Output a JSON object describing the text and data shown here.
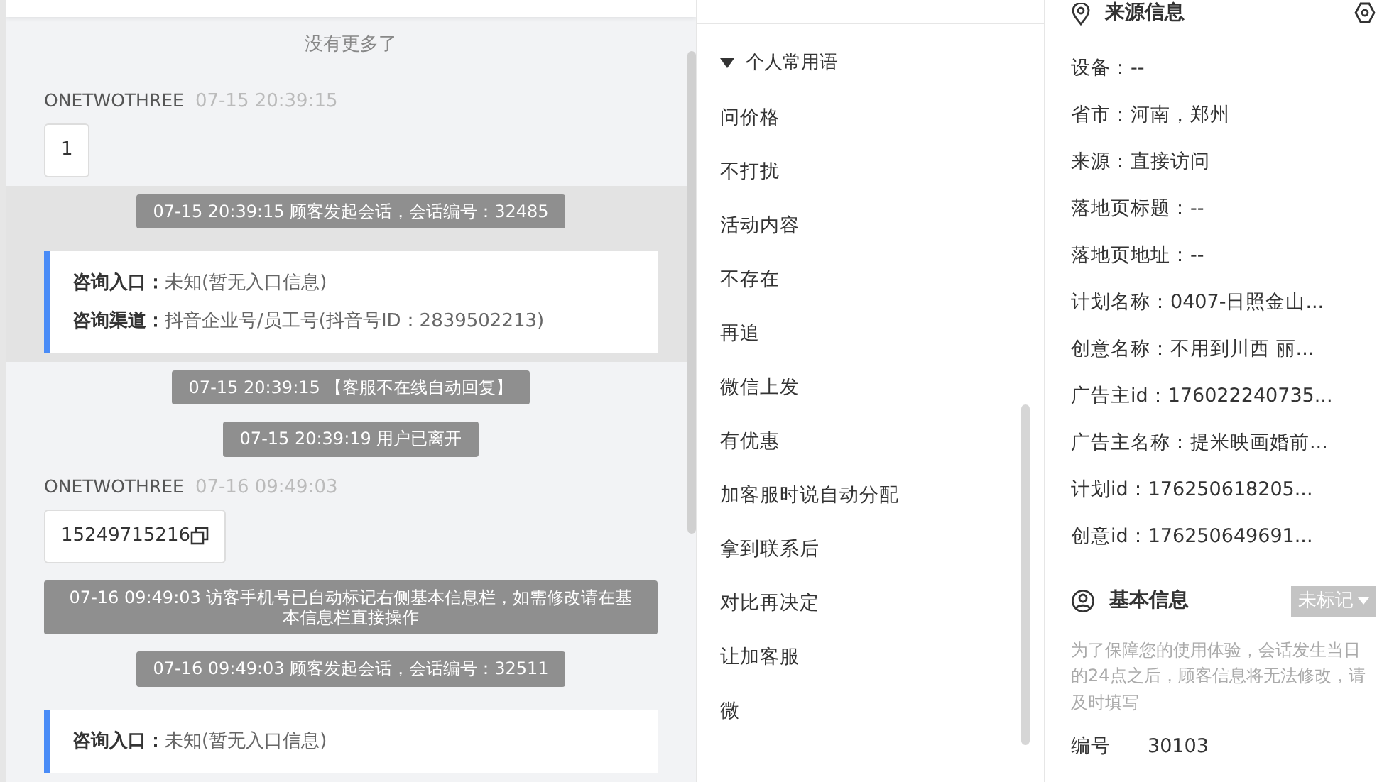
{
  "chat": {
    "end_notice": "没有更多了",
    "messages": [
      {
        "kind": "customer",
        "highlighted": false,
        "sender": "ONETWOTHREE",
        "time": "07-15 20:39:15",
        "text": "1",
        "copyable": false
      },
      {
        "kind": "system",
        "highlighted": true,
        "text": "07-15 20:39:15 顾客发起会话，会话编号：32485"
      },
      {
        "kind": "consult",
        "highlighted": true,
        "rows": [
          {
            "label": "咨询入口：",
            "value": "未知(暂无入口信息)"
          },
          {
            "label": "咨询渠道：",
            "value": "抖音企业号/员工号(抖音号ID：2839502213)"
          }
        ]
      },
      {
        "kind": "system",
        "highlighted": false,
        "text": "07-15 20:39:15 【客服不在线自动回复】"
      },
      {
        "kind": "system",
        "highlighted": false,
        "text": "07-15 20:39:19 用户已离开"
      },
      {
        "kind": "customer",
        "highlighted": false,
        "sender": "ONETWOTHREE",
        "time": "07-16 09:49:03",
        "text": "15249715216",
        "copyable": true
      },
      {
        "kind": "system",
        "highlighted": false,
        "text": "07-16 09:49:03 访客手机号已自动标记右侧基本信息栏，如需修改请在基本信息栏直接操作"
      },
      {
        "kind": "system",
        "highlighted": false,
        "text": "07-16 09:49:03 顾客发起会话，会话编号：32511"
      },
      {
        "kind": "consult",
        "highlighted": false,
        "rows": [
          {
            "label": "咨询入口：",
            "value": "未知(暂无入口信息)"
          }
        ]
      }
    ]
  },
  "phrases": {
    "group": {
      "title": "个人常用语",
      "expanded": true
    },
    "items": [
      "问价格",
      "不打扰",
      "活动内容",
      "不存在",
      "再追",
      "微信上发",
      "有优惠",
      "加客服时说自动分配",
      "拿到联系后",
      "对比再决定",
      "让加客服",
      "微"
    ]
  },
  "source_info": {
    "title": "来源信息",
    "fields": [
      "设备：--",
      "省市：河南，郑州",
      "来源：直接访问",
      "落地页标题：--",
      "落地页地址：--",
      "计划名称：0407-日照金山...",
      "创意名称：不用到川西 丽...",
      "广告主id：176022240735...",
      "广告主名称：提米映画婚前...",
      "计划id：176250618205...",
      "创意id：176250649691..."
    ]
  },
  "basic_info": {
    "title": "基本信息",
    "tag": "未标记",
    "notice": "为了保障您的使用体验，会话发生当日的24点之后，顾客信息将无法修改，请及时填写",
    "fields": [
      {
        "label": "编号",
        "value": "30103"
      }
    ]
  }
}
